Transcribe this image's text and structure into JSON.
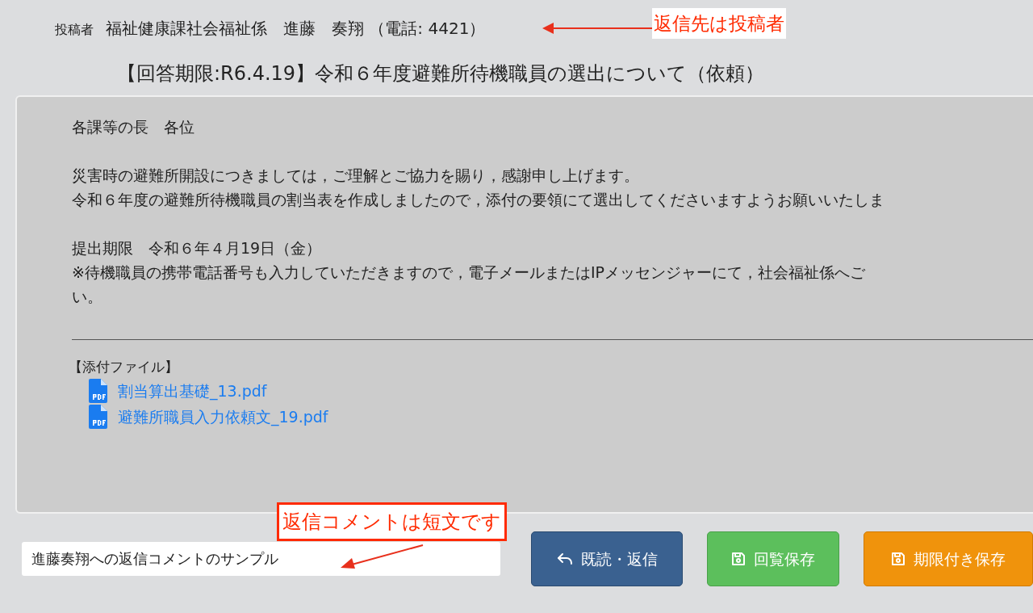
{
  "poster": {
    "label": "投稿者",
    "value": "福祉健康課社会福祉係　進藤　奏翔 （電話: 4421）"
  },
  "title": "【回答期限:R6.4.19】令和６年度避難所待機職員の選出について（依頼）",
  "message": {
    "paragraphs": [
      [
        "各課等の長　各位"
      ],
      [
        "災害時の避難所開設につきましては，ご理解とご協力を賜り，感謝申し上げます。",
        "令和６年度の避難所待機職員の割当表を作成しましたので，添付の要領にて選出してくださいますようお願いいたしま"
      ],
      [
        "提出期限　令和６年４月19日（金）",
        "※待機職員の携帯電話番号も入力していただきますので，電子メールまたはIPメッセンジャーにて，社会福祉係へご",
        "い。"
      ]
    ]
  },
  "attachments": {
    "heading": "【添付ファイル】",
    "files": [
      {
        "name": "割当算出基礎_13.pdf"
      },
      {
        "name": "避難所職員入力依頼文_19.pdf"
      }
    ]
  },
  "reply": {
    "value": "進藤奏翔への返信コメントのサンプル"
  },
  "buttons": [
    {
      "label": "既読・返信",
      "kind": "reply"
    },
    {
      "label": "回覧保存",
      "kind": "save"
    },
    {
      "label": "期限付き保存",
      "kind": "deadline"
    }
  ],
  "annotations": [
    {
      "text": "返信先は投稿者",
      "kind": "plain"
    },
    {
      "text": "返信コメントは短文です",
      "kind": "boxed"
    }
  ]
}
